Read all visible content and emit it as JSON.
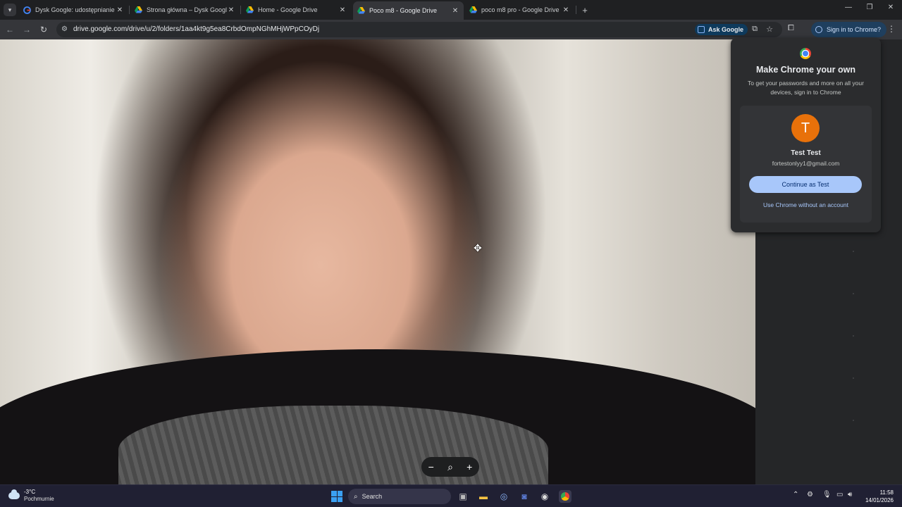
{
  "tabs": [
    {
      "title": "Dysk Google: udostępnianie pl",
      "favicon": "google-g-icon",
      "active": false
    },
    {
      "title": "Strona główna – Dysk Google",
      "favicon": "google-drive-icon",
      "active": false
    },
    {
      "title": "Home - Google Drive",
      "favicon": "google-drive-icon",
      "active": false
    },
    {
      "title": "Poco m8 - Google Drive",
      "favicon": "google-drive-icon",
      "active": true
    },
    {
      "title": "poco m8 pro - Google Drive",
      "favicon": "google-drive-icon",
      "active": false
    }
  ],
  "toolbar": {
    "url": "drive.google.com/drive/u/2/folders/1aa4kt9g5ea8CrbdOmpNGhMHjWPpCOyDj",
    "ask_google": "Ask Google",
    "sign_in": "Sign in to Chrome?"
  },
  "popup": {
    "title": "Make Chrome your own",
    "description": "To get your passwords and more on all your devices, sign in to Chrome",
    "avatar_letter": "T",
    "account_name": "Test Test",
    "account_email": "fortestonlyy1@gmail.com",
    "continue_label": "Continue as Test",
    "no_account_label": "Use Chrome without an account"
  },
  "zoom_controls": {
    "minus": "−",
    "zoom": "⌕",
    "plus": "+"
  },
  "taskbar": {
    "temperature": "-3°C",
    "weather": "Pochmurnie",
    "search_placeholder": "Search",
    "time": "11:58",
    "date": "14/01/2026"
  },
  "colors": {
    "accent": "#a8c7fa",
    "avatar": "#e8710a",
    "tabstrip": "#1f2022",
    "toolbar": "#35363a",
    "taskbar": "#202033"
  }
}
